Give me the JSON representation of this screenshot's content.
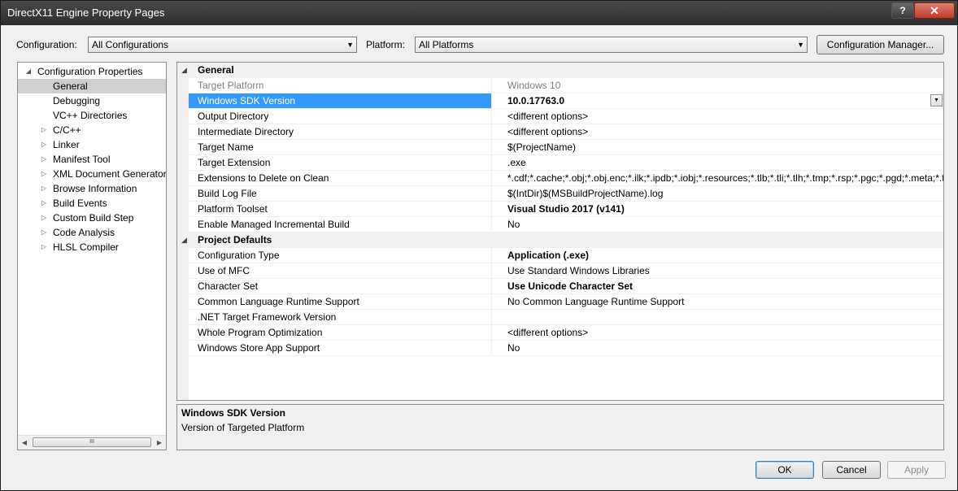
{
  "window": {
    "title": "DirectX11 Engine Property Pages",
    "help_label": "?",
    "close_label": "✕"
  },
  "toolbar": {
    "configuration_label": "Configuration:",
    "configuration_value": "All Configurations",
    "platform_label": "Platform:",
    "platform_value": "All Platforms",
    "config_manager_label": "Configuration Manager..."
  },
  "tree": {
    "items": [
      {
        "label": "Configuration Properties",
        "expander": "◢"
      },
      {
        "label": "General"
      },
      {
        "label": "Debugging"
      },
      {
        "label": "VC++ Directories"
      },
      {
        "label": "C/C++",
        "expander": "▷"
      },
      {
        "label": "Linker",
        "expander": "▷"
      },
      {
        "label": "Manifest Tool",
        "expander": "▷"
      },
      {
        "label": "XML Document Generator",
        "expander": "▷"
      },
      {
        "label": "Browse Information",
        "expander": "▷"
      },
      {
        "label": "Build Events",
        "expander": "▷"
      },
      {
        "label": "Custom Build Step",
        "expander": "▷"
      },
      {
        "label": "Code Analysis",
        "expander": "▷"
      },
      {
        "label": "HLSL Compiler",
        "expander": "▷"
      }
    ],
    "scroll_left": "◀",
    "scroll_right": "▶",
    "scroll_grip": "III"
  },
  "grid": {
    "categories": [
      {
        "name": "General",
        "expander": "◢",
        "rows": [
          {
            "name": "Target Platform",
            "value": "Windows 10"
          },
          {
            "name": "Windows SDK Version",
            "value": "10.0.17763.0"
          },
          {
            "name": "Output Directory",
            "value": "<different options>"
          },
          {
            "name": "Intermediate Directory",
            "value": "<different options>"
          },
          {
            "name": "Target Name",
            "value": "$(ProjectName)"
          },
          {
            "name": "Target Extension",
            "value": ".exe"
          },
          {
            "name": "Extensions to Delete on Clean",
            "value": "*.cdf;*.cache;*.obj;*.obj.enc;*.ilk;*.ipdb;*.iobj;*.resources;*.tlb;*.tli;*.tlh;*.tmp;*.rsp;*.pgc;*.pgd;*.meta;*.tlog"
          },
          {
            "name": "Build Log File",
            "value": "$(IntDir)$(MSBuildProjectName).log"
          },
          {
            "name": "Platform Toolset",
            "value": "Visual Studio 2017 (v141)"
          },
          {
            "name": "Enable Managed Incremental Build",
            "value": "No"
          }
        ]
      },
      {
        "name": "Project Defaults",
        "expander": "◢",
        "rows": [
          {
            "name": "Configuration Type",
            "value": "Application (.exe)"
          },
          {
            "name": "Use of MFC",
            "value": "Use Standard Windows Libraries"
          },
          {
            "name": "Character Set",
            "value": "Use Unicode Character Set"
          },
          {
            "name": "Common Language Runtime Support",
            "value": "No Common Language Runtime Support"
          },
          {
            "name": ".NET Target Framework Version",
            "value": ""
          },
          {
            "name": "Whole Program Optimization",
            "value": "<different options>"
          },
          {
            "name": "Windows Store App Support",
            "value": "No"
          }
        ]
      }
    ],
    "dropdown_glyph": "▼"
  },
  "description": {
    "title": "Windows SDK Version",
    "text": "Version of Targeted Platform"
  },
  "buttons": {
    "ok": "OK",
    "cancel": "Cancel",
    "apply": "Apply"
  },
  "combo_arrow": "▼",
  "colors": {
    "selection": "#3399ff",
    "titlebar": "#2d2d2d",
    "close": "#c03a28"
  }
}
